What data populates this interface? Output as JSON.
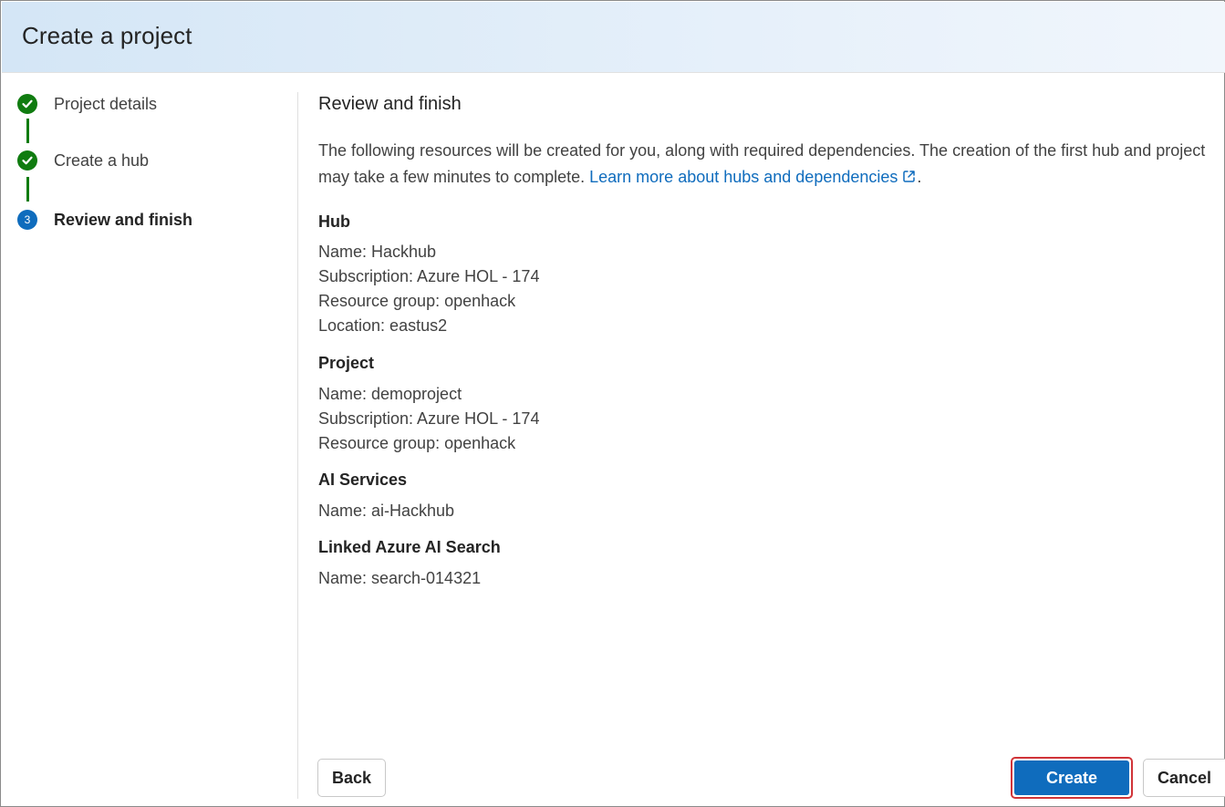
{
  "dialog": {
    "title": "Create a project"
  },
  "stepper": {
    "steps": [
      {
        "label": "Project details",
        "status": "complete"
      },
      {
        "label": "Create a hub",
        "status": "complete"
      },
      {
        "label": "Review and finish",
        "status": "current",
        "number": "3"
      }
    ]
  },
  "main": {
    "heading": "Review and finish",
    "intro_text": "The following resources will be created for you, along with required dependencies. The creation of the first hub and project may take a few minutes to complete. ",
    "intro_link": "Learn more about hubs and dependencies",
    "intro_period": ".",
    "sections": [
      {
        "title": "Hub",
        "lines": [
          "Name: Hackhub",
          "Subscription: Azure HOL - 174",
          "Resource group: openhack",
          "Location: eastus2"
        ]
      },
      {
        "title": "Project",
        "lines": [
          "Name: demoproject",
          "Subscription: Azure HOL - 174",
          "Resource group: openhack"
        ]
      },
      {
        "title": "AI Services",
        "lines": [
          "Name: ai-Hackhub"
        ]
      },
      {
        "title": "Linked Azure AI Search",
        "lines": [
          "Name: search-014321"
        ]
      }
    ]
  },
  "footer": {
    "back_label": "Back",
    "create_label": "Create",
    "cancel_label": "Cancel"
  },
  "colors": {
    "accent": "#0f6cbd",
    "success": "#107c10",
    "highlight_border": "#d13438"
  }
}
